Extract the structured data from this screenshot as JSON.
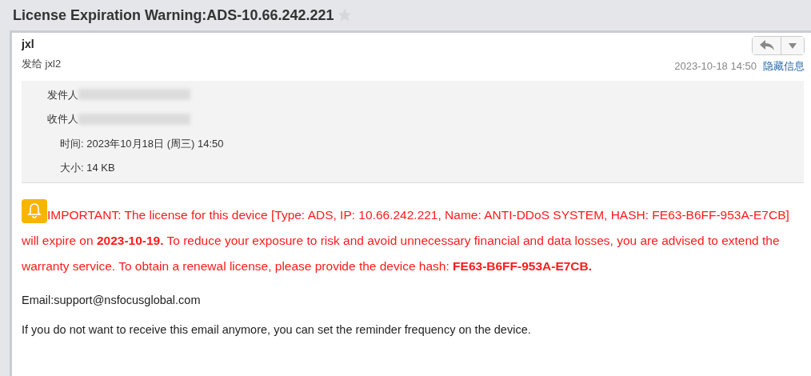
{
  "subject": {
    "title": "License Expiration Warning:ADS-10.66.242.221",
    "starred": false
  },
  "header": {
    "sender": "jxl",
    "to_line": "发给 jxl2",
    "date": "2023-10-18 14:50",
    "toggle_link": "隐藏信息"
  },
  "details": [
    {
      "label": "发件人",
      "redacted": true
    },
    {
      "label": "收件人",
      "redacted": true
    },
    {
      "label": "时间: 2023年10月18日 (周三) 14:50",
      "redacted": false
    },
    {
      "label": "大小: 14 KB",
      "redacted": false
    }
  ],
  "body": {
    "warning": "IMPORTANT: The license for this device [Type: ADS, IP: 10.66.242.221, Name: ANTI-DDoS SYSTEM, HASH: FE63-B6FF-953A-E7CB] will expire on **2023-10-19.** To reduce your exposure to risk and avoid unnecessary financial and data losses, you are advised to extend the warranty service. To obtain a renewal license, please provide the device hash: **FE63-B6FF-953A-E7CB.**",
    "paragraphs": [
      "Email:support@nsfocusglobal.com",
      "If you do not want to receive this email anymore, you can set the reminder frequency on the device."
    ]
  }
}
